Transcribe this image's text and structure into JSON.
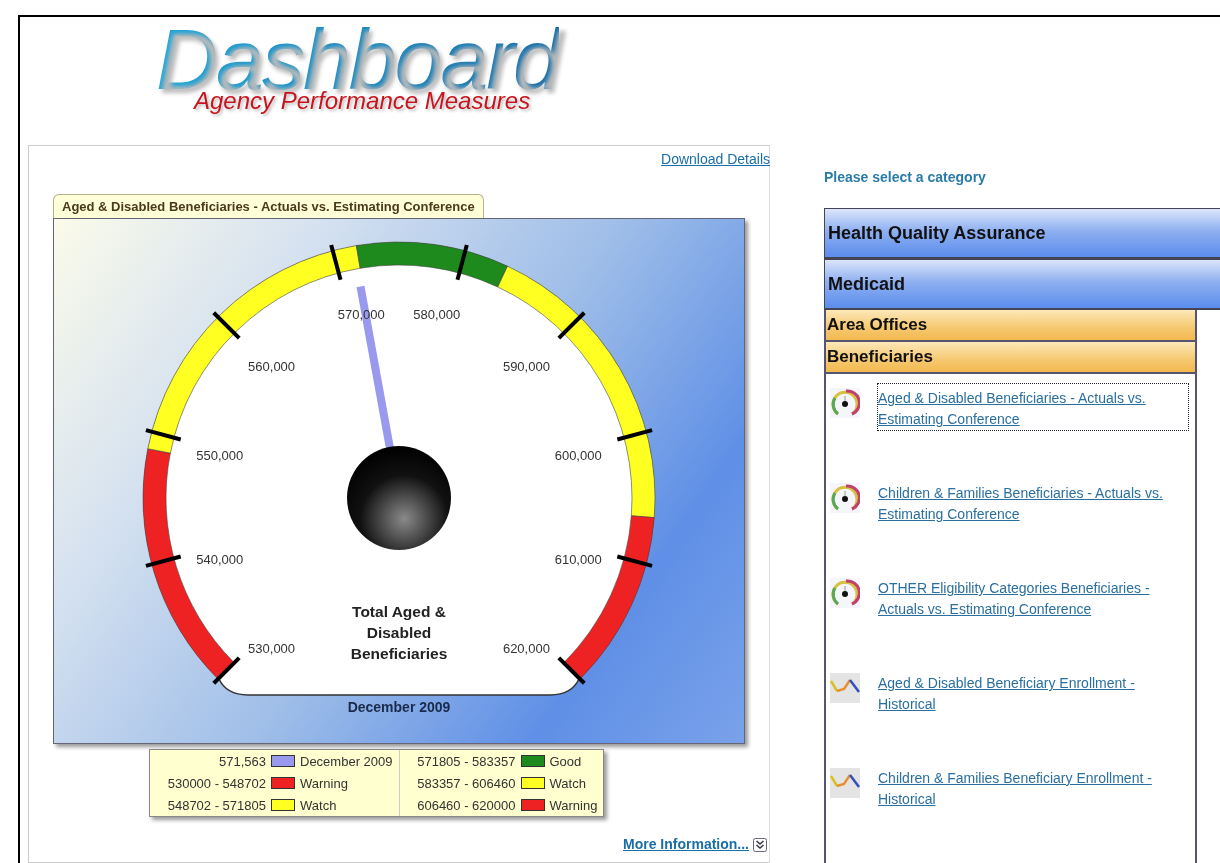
{
  "header": {
    "title": "Dashboard",
    "subtitle": "Agency Performance Measures"
  },
  "chart_panel": {
    "download_link": "Download Details",
    "tab_title": "Aged & Disabled Beneficiaries - Actuals vs. Estimating Conference",
    "gauge": {
      "title": "Total Aged & Disabled Beneficiaries",
      "period": "December 2009",
      "needle": {
        "level": 0.4618,
        "color": "#9999ee"
      },
      "ticks": [
        "530,000",
        "540,000",
        "550,000",
        "560,000",
        "570,000",
        "580,000",
        "590,000",
        "600,000",
        "610,000",
        "620,000"
      ],
      "bands": [
        {
          "color": "#ee2222",
          "level": 0.2078
        },
        {
          "color": "#ffff22",
          "level": 0.4645
        },
        {
          "color": "#1e8a1e",
          "level": 0.5929
        },
        {
          "color": "#ffff22",
          "level": 0.8496
        },
        {
          "color": "#ee2222",
          "level": 1
        }
      ]
    },
    "legend": [
      {
        "value": "571,563",
        "color": "#9999ee",
        "label": "December 2009"
      },
      {
        "value": "530000 - 548702",
        "color": "#ee2222",
        "label": "Warning"
      },
      {
        "value": "548702 - 571805",
        "color": "#ffff22",
        "label": "Watch"
      },
      {
        "value": "571805 - 583357",
        "color": "#1e8a1e",
        "label": "Good"
      },
      {
        "value": "583357 - 606460",
        "color": "#ffff22",
        "label": "Watch"
      },
      {
        "value": "606460 - 620000",
        "color": "#ee2222",
        "label": "Warning"
      }
    ],
    "more_link": "More Information..."
  },
  "categories": {
    "prompt": "Please select a category",
    "groups": [
      {
        "label": "Health Quality Assurance"
      },
      {
        "label": "Medicaid",
        "children": [
          {
            "label": "Area Offices"
          },
          {
            "label": "Beneficiaries",
            "items": [
              {
                "kind": "gauge",
                "label": "Aged & Disabled Beneficiaries - Actuals vs. Estimating Conference",
                "selected": true
              },
              {
                "kind": "gauge",
                "label": "Children & Families Beneficiaries - Actuals vs. Estimating Conference",
                "selected": false
              },
              {
                "kind": "gauge",
                "label": "OTHER Eligibility Categories Beneficiaries - Actuals vs. Estimating Conference",
                "selected": false
              },
              {
                "kind": "trend",
                "label": "Aged & Disabled Beneficiary Enrollment - Historical",
                "selected": false
              },
              {
                "kind": "trend",
                "label": "Children & Families Beneficiary Enrollment - Historical",
                "selected": false
              }
            ]
          }
        ]
      }
    ]
  }
}
